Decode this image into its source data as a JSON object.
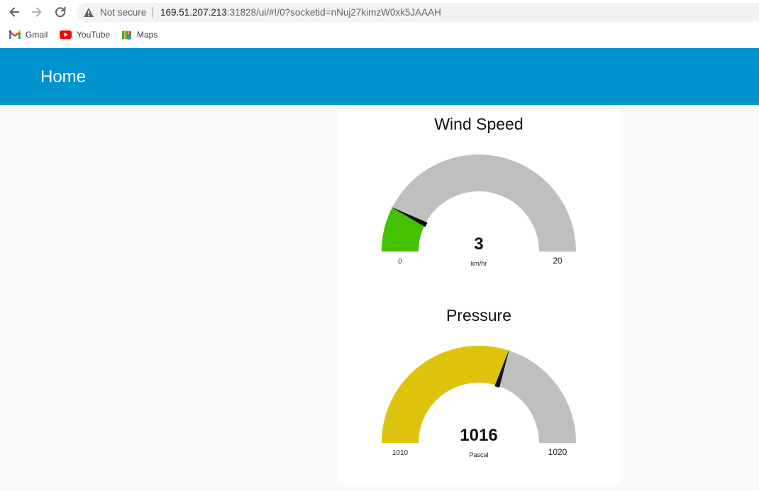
{
  "browser": {
    "security_label": "Not secure",
    "url_host": "169.51.207.213",
    "url_rest": ":31828/ui/#!/0?socketid=nNuj27kimzW0xk5JAAAH",
    "bookmarks": [
      {
        "label": "Gmail",
        "icon": "gmail-icon"
      },
      {
        "label": "YouTube",
        "icon": "youtube-icon"
      },
      {
        "label": "Maps",
        "icon": "maps-icon"
      }
    ]
  },
  "header": {
    "title": "Home",
    "color": "#0094ce"
  },
  "gauges": [
    {
      "title": "Wind Speed",
      "value": 3,
      "value_text": "3",
      "units": "km/hr",
      "min": 0,
      "max": 20,
      "min_text": "0",
      "max_text": "20",
      "fill_color": "#44c100",
      "track_color": "#bfbfbf"
    },
    {
      "title": "Pressure",
      "value": 1016,
      "value_text": "1016",
      "units": "Pascal",
      "min": 1010,
      "max": 1020,
      "min_text": "1010",
      "max_text": "1020",
      "fill_color": "#dfc40d",
      "track_color": "#bfbfbf"
    }
  ]
}
